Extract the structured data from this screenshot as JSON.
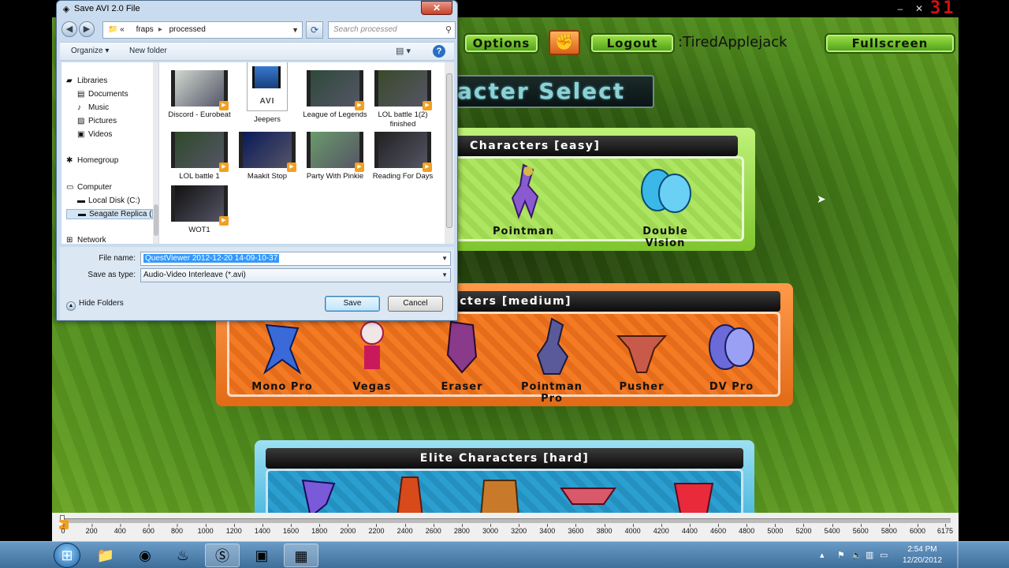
{
  "window_controls": {
    "minimize": "–",
    "close": "✕"
  },
  "hud_counter": "31",
  "game": {
    "options_label": "Options",
    "logout_label": "Logout",
    "username": ":TiredApplejack",
    "fullscreen_label": "Fullscreen",
    "screen_title": "acter Select",
    "panels": [
      {
        "title": "Characters [easy]",
        "characters": [
          "Pointman",
          "Double Vision"
        ]
      },
      {
        "title": "aracters [medium]",
        "characters": [
          "Mono Pro",
          "Vegas",
          "Eraser",
          "Pointman Pro",
          "Pusher",
          "DV Pro"
        ]
      },
      {
        "title": "Elite Characters [hard]",
        "characters": []
      }
    ]
  },
  "dialog": {
    "title": "Save AVI 2.0 File",
    "breadcrumb": [
      "«",
      "fraps",
      "processed"
    ],
    "search_placeholder": "Search processed",
    "toolbar": {
      "organize": "Organize ▾",
      "new_folder": "New folder"
    },
    "nav": [
      {
        "label": "Libraries",
        "icon": "libraries-icon"
      },
      {
        "label": "Documents",
        "icon": "documents-icon"
      },
      {
        "label": "Music",
        "icon": "music-icon"
      },
      {
        "label": "Pictures",
        "icon": "pictures-icon"
      },
      {
        "label": "Videos",
        "icon": "videos-icon"
      },
      {
        "label": "Homegroup",
        "icon": "homegroup-icon"
      },
      {
        "label": "Computer",
        "icon": "computer-icon"
      },
      {
        "label": "Local Disk (C:)",
        "icon": "disk-icon"
      },
      {
        "label": "Seagate Replica (",
        "icon": "drive-icon"
      },
      {
        "label": "Network",
        "icon": "network-icon"
      }
    ],
    "files": [
      {
        "name": "Discord - Eurobeat",
        "color": "#cfd8d0"
      },
      {
        "name": "Jeepers",
        "color": "#2f6fc0"
      },
      {
        "name": "League of Legends",
        "color": "#2e4a3a"
      },
      {
        "name": "LOL battle 1(2) finished",
        "color": "#3a4a2a"
      },
      {
        "name": "LOL battle 1",
        "color": "#2e4a2a"
      },
      {
        "name": "Maakit Stop",
        "color": "#0a1a5a"
      },
      {
        "name": "Party With Pinkie",
        "color": "#6a9a6a"
      },
      {
        "name": "Reading For Days",
        "color": "#222222"
      },
      {
        "name": "WOT1",
        "color": "#111111"
      }
    ],
    "avi_tag": "AVI",
    "file_name_label": "File name:",
    "file_name_value": "QuestViewer 2012-12-20 14-09-10-37",
    "save_type_label": "Save as type:",
    "save_type_value": "Audio-Video Interleave (*.avi)",
    "hide_folders": "Hide Folders",
    "save_button": "Save",
    "cancel_button": "Cancel"
  },
  "ruler": {
    "ticks": [
      "0",
      "200",
      "400",
      "600",
      "800",
      "1000",
      "1200",
      "1400",
      "1600",
      "1800",
      "2000",
      "2200",
      "2400",
      "2600",
      "2800",
      "3000",
      "3200",
      "3400",
      "3600",
      "3800",
      "4000",
      "4200",
      "4400",
      "4600",
      "4800",
      "5000",
      "5200",
      "5400",
      "5600",
      "5800",
      "6000",
      "6175"
    ]
  },
  "taskbar": {
    "items": [
      {
        "name": "explorer",
        "icon": "folder-icon",
        "glyph": "📁",
        "active": false
      },
      {
        "name": "chrome",
        "icon": "chrome-icon",
        "glyph": "◉",
        "active": false
      },
      {
        "name": "steam",
        "icon": "steam-icon",
        "glyph": "♨",
        "active": false
      },
      {
        "name": "skype",
        "icon": "skype-icon",
        "glyph": "Ⓢ",
        "active": true
      },
      {
        "name": "fraps",
        "icon": "fraps-icon",
        "glyph": "▣",
        "active": false
      },
      {
        "name": "virtualdub",
        "icon": "virtualdub-icon",
        "glyph": "▦",
        "active": true
      }
    ],
    "time": "2:54 PM",
    "date": "12/20/2012"
  },
  "colors": {
    "accent_green": "#6aa625",
    "dialog_bg": "#c9dcef",
    "selection": "#3399ff"
  }
}
